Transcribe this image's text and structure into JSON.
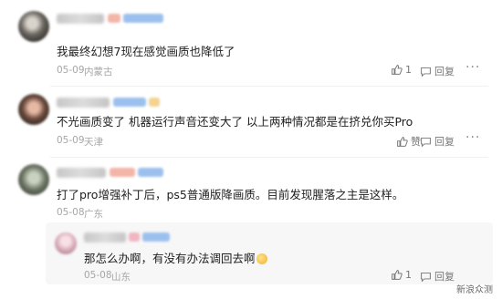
{
  "comments": [
    {
      "text": "我最终幻想7现在感觉画质也降低了",
      "date": "05-09",
      "location": "内蒙古",
      "likes": "1",
      "reply_label": "回复"
    },
    {
      "text": "不光画质变了 机器运行声音还变大了 以上两种情况都是在挤兑你买Pro",
      "date": "05-09",
      "location": "天津",
      "likes": "赞",
      "reply_label": "回复"
    },
    {
      "text": "打了pro增强补丁后，ps5普通版降画质。目前发现腥落之主是这样。",
      "date": "05-08",
      "location": "广东",
      "likes": "",
      "reply_label": ""
    }
  ],
  "reply": {
    "text": "那怎么办啊，有没有办法调回去啊",
    "date": "05-08",
    "location": "山东",
    "likes": "1",
    "reply_label": "回复"
  },
  "more_label": "···",
  "watermark": "新浪众测",
  "colors": {
    "text": "#1f1f1f",
    "meta": "#a6a6a6",
    "background": "#ffffff"
  }
}
